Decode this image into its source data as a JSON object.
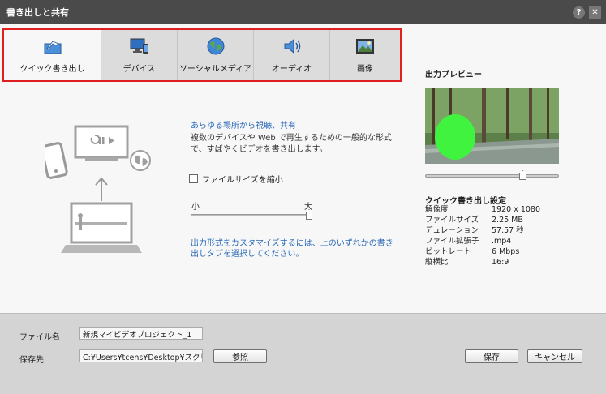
{
  "window": {
    "title": "書き出しと共有",
    "help_icon": "?",
    "close_icon": "✕"
  },
  "tabs": [
    {
      "label": "クイック書き出し",
      "icon": "quick-export-icon",
      "active": true
    },
    {
      "label": "デバイス",
      "icon": "device-icon",
      "active": false
    },
    {
      "label": "ソーシャルメディア",
      "icon": "globe-icon",
      "active": false
    },
    {
      "label": "オーディオ",
      "icon": "speaker-icon",
      "active": false
    },
    {
      "label": "画像",
      "icon": "picture-icon",
      "active": false
    }
  ],
  "quick_export": {
    "title": "あらゆる場所から視聴、共有",
    "description": "複数のデバイスや Web で再生するための一般的な形式で、すばやくビデオを書き出します。",
    "reduce_size_label": "ファイルサイズを縮小",
    "reduce_size_checked": false,
    "slider_small": "小",
    "slider_large": "大",
    "slider_value": 1.0,
    "hint": "出力形式をカスタマイズするには、上のいずれかの書き出しタブを選択してください。"
  },
  "preview": {
    "title": "出力プレビュー",
    "scrub_position": 0.74
  },
  "settings": {
    "title": "クイック書き出し設定",
    "rows": [
      {
        "key": "解像度",
        "value": "1920 x 1080"
      },
      {
        "key": "ファイルサイズ",
        "value": "2.25 MB"
      },
      {
        "key": "デュレーション",
        "value": "57.57 秒"
      },
      {
        "key": "ファイル拡張子",
        "value": ".mp4"
      },
      {
        "key": "ビットレート",
        "value": "6 Mbps"
      },
      {
        "key": "縦横比",
        "value": "16:9"
      }
    ]
  },
  "bottom": {
    "filename_label": "ファイル名",
    "filename_value": "新規マイビデオプロジェクト_1",
    "save_location_label": "保存先",
    "save_location_value": "C:¥Users¥tcens¥Desktop¥スクリーンショ",
    "browse_label": "参照",
    "save_label": "保存",
    "cancel_label": "キャンセル"
  },
  "colors": {
    "accent": "#2a6ab7",
    "highlight_border": "#e02020",
    "titlebar": "#4a4a4a"
  }
}
